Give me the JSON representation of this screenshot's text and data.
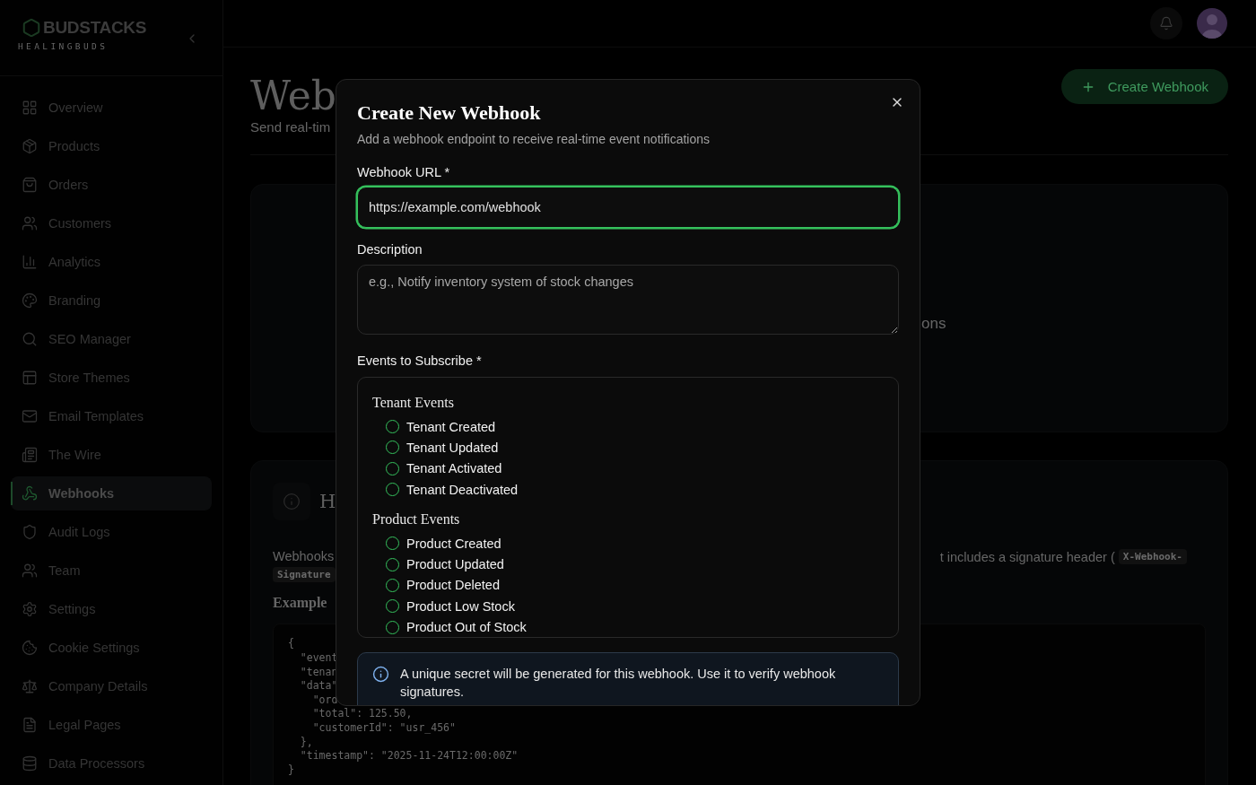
{
  "sidebar": {
    "logo": "BUDSTACKS",
    "tenant": "HEALINGBUDS",
    "items": [
      {
        "label": "Overview",
        "selected": false
      },
      {
        "label": "Products",
        "selected": false
      },
      {
        "label": "Orders",
        "selected": false
      },
      {
        "label": "Customers",
        "selected": false
      },
      {
        "label": "Analytics",
        "selected": false
      },
      {
        "label": "Branding",
        "selected": false
      },
      {
        "label": "SEO Manager",
        "selected": false
      },
      {
        "label": "Store Themes",
        "selected": false
      },
      {
        "label": "Email Templates",
        "selected": false
      },
      {
        "label": "The Wire",
        "selected": false
      },
      {
        "label": "Webhooks",
        "selected": true
      },
      {
        "label": "Audit Logs",
        "selected": false
      },
      {
        "label": "Team",
        "selected": false
      },
      {
        "label": "Settings",
        "selected": false
      },
      {
        "label": "Cookie Settings",
        "selected": false
      },
      {
        "label": "Company Details",
        "selected": false
      },
      {
        "label": "Legal Pages",
        "selected": false
      },
      {
        "label": "Data Processors",
        "selected": false
      }
    ]
  },
  "page": {
    "title": "Web",
    "subtitle": "Send real-tim",
    "create_button": "Create Webhook"
  },
  "empty_state": {
    "text": "ons"
  },
  "help": {
    "heading": "H",
    "intro": "Webhooks",
    "intro_tail": "t includes a signature header (",
    "code_chip": "X-Webhook-",
    "code_chip_2": "Signature",
    "example_heading": "Example",
    "code_lines": [
      "{",
      "  \"event",
      "  \"tenan",
      "  \"data\"",
      "    \"ord",
      "    \"total\": 125.50,",
      "    \"customerId\": \"usr_456\"",
      "  },",
      "  \"timestamp\": \"2025-11-24T12:00:00Z\"",
      "}"
    ]
  },
  "dialog": {
    "title": "Create New Webhook",
    "subtitle": "Add a webhook endpoint to receive real-time event notifications",
    "url_label": "Webhook URL *",
    "url_value": "https://example.com/webhook",
    "url_focused": true,
    "description_label": "Description",
    "description_placeholder": "e.g., Notify inventory system of stock changes",
    "events_label": "Events to Subscribe *",
    "groups": [
      {
        "title": "Tenant Events",
        "events": [
          {
            "label": "Tenant Created",
            "checked": false
          },
          {
            "label": "Tenant Updated",
            "checked": false
          },
          {
            "label": "Tenant Activated",
            "checked": false
          },
          {
            "label": "Tenant Deactivated",
            "checked": false
          }
        ]
      },
      {
        "title": "Product Events",
        "events": [
          {
            "label": "Product Created",
            "checked": false
          },
          {
            "label": "Product Updated",
            "checked": false
          },
          {
            "label": "Product Deleted",
            "checked": false
          },
          {
            "label": "Product Low Stock",
            "checked": false
          },
          {
            "label": "Product Out of Stock",
            "checked": false
          }
        ]
      }
    ],
    "notice": "A unique secret will be generated for this webhook. Use it to verify webhook signatures."
  }
}
